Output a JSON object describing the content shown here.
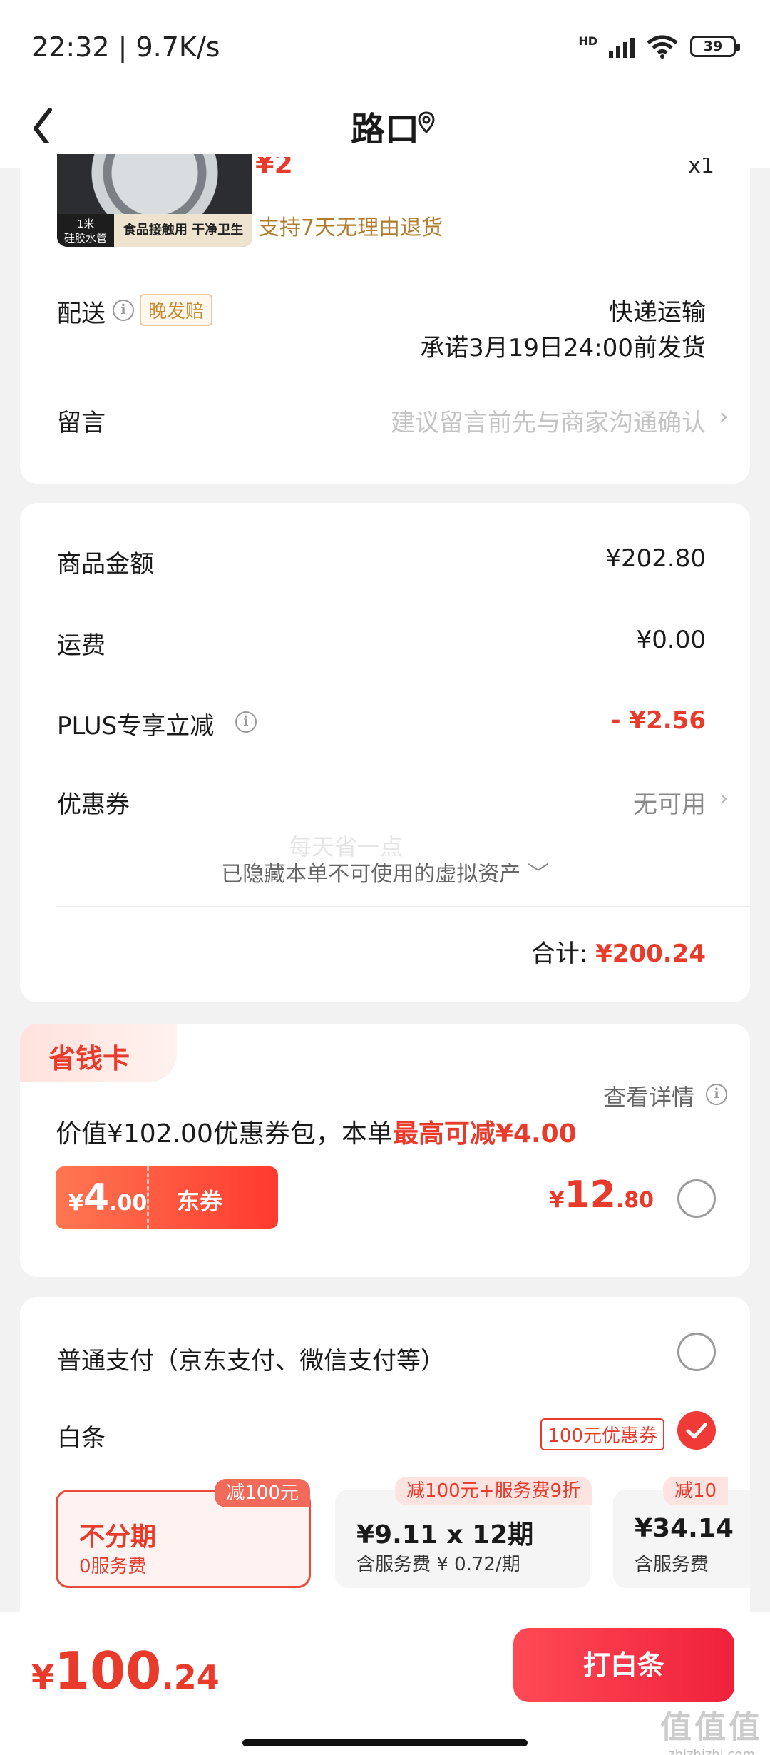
{
  "status_bar": {
    "time": "22:32 | 9.7K/s",
    "network": "HD",
    "wifi_label": "6",
    "battery": "39"
  },
  "header": {
    "title": "路口"
  },
  "product": {
    "price_fragment": "¥2",
    "qty_fragment": "x1",
    "thumb_tag_left": "1米\n硅胶水管",
    "thumb_tag_right": "食品接触用 干净卫生",
    "return_policy": "支持7天无理由退货"
  },
  "delivery": {
    "label": "配送",
    "badge": "晚发赔",
    "method": "快递运输",
    "promise": "承诺3月19日24:00前发货"
  },
  "message": {
    "label": "留言",
    "placeholder": "建议留言前先与商家沟通确认"
  },
  "summary": {
    "goods_label": "商品金额",
    "goods_value": "¥202.80",
    "shipping_label": "运费",
    "shipping_value": "¥0.00",
    "plus_label": "PLUS专享立减",
    "plus_value": "- ¥2.56",
    "coupon_label": "优惠券",
    "coupon_value": "无可用",
    "hidden_assets": "已隐藏本单不可使用的虚拟资产",
    "total_label": "合计:",
    "total_value": "¥200.24"
  },
  "overlay": "每天省一点",
  "savings_card": {
    "title": "省钱卡",
    "detail_link": "查看详情",
    "desc_prefix": "价值¥102.00优惠券包，本单",
    "desc_highlight": "最高可减¥4.00",
    "coupon_currency": "¥",
    "coupon_int": "4",
    "coupon_dec": ".00",
    "coupon_name": "东券",
    "price_currency": "¥",
    "price_int": "12",
    "price_dec": ".80",
    "selected": false
  },
  "payment": {
    "normal_label": "普通支付（京东支付、微信支付等）",
    "normal_selected": false,
    "baitiao_label": "白条",
    "baitiao_badge": "100元优惠券",
    "baitiao_selected": true,
    "plans": [
      {
        "tag": "减100元",
        "main": "不分期",
        "sub": "0服务费",
        "selected": true
      },
      {
        "tag": "减100元+服务费9折",
        "main": "¥9.11 x 12期",
        "sub": "含服务费 ¥ 0.72/期",
        "selected": false
      },
      {
        "tag": "减10",
        "main": "¥34.14",
        "sub": "含服务费",
        "selected": false
      }
    ]
  },
  "bottom_bar": {
    "currency": "¥",
    "amount_int": "100",
    "amount_dec": ".24",
    "pay_button": "打白条"
  },
  "watermark": {
    "logo": "值值值",
    "site": "zhizhizhi.com"
  },
  "colors": {
    "accent_red": "#e93b2c",
    "gold_text": "#b27b2c",
    "page_bg": "#f2f2f2"
  }
}
